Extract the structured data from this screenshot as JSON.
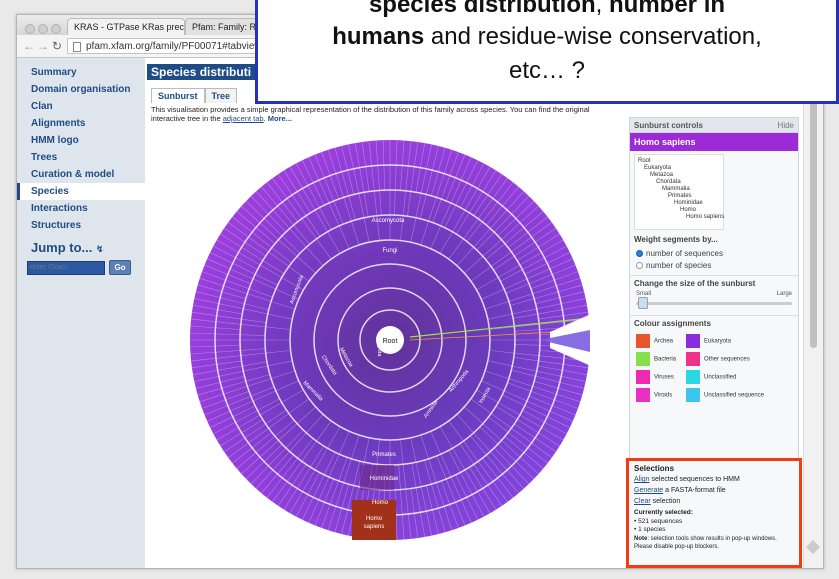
{
  "browser": {
    "tabs": [
      {
        "title": "KRAS - GTPase KRas prec",
        "close": "×"
      },
      {
        "title": "Pfam: Family: Ra"
      }
    ],
    "url": "pfam.xfam.org/family/PF00071#tabview=ta"
  },
  "sidebar": {
    "items": [
      {
        "label": "Summary"
      },
      {
        "label": "Domain organisation"
      },
      {
        "label": "Clan"
      },
      {
        "label": "Alignments"
      },
      {
        "label": "HMM logo"
      },
      {
        "label": "Trees"
      },
      {
        "label": "Curation & model"
      },
      {
        "label": "Species"
      },
      {
        "label": "Interactions"
      },
      {
        "label": "Structures"
      }
    ],
    "active_index": 7,
    "jump_title": "Jump to...",
    "jump_input_placeholder": "enter ID/acc",
    "go_label": "Go"
  },
  "main": {
    "section_title": "Species distributi",
    "tabs": [
      "Sunburst",
      "Tree"
    ],
    "description_1": "This visualisation provides a simple graphical representation of the distribution of this family across species. You can find the original interactive tree in the ",
    "description_link": "adjacent tab",
    "description_more": "More..."
  },
  "sunburst": {
    "labels": {
      "root": "Root",
      "eukaryota": "Eukaryota",
      "fungi": "Fungi",
      "ascomycota": "Ascomycota",
      "metazoa": "Metazoa",
      "chordata": "Chordata",
      "mammalia": "Mammalia",
      "primates": "Primates",
      "hominidae": "Hominidae",
      "homo": "Homo",
      "homo_sapiens_1": "Homo",
      "homo_sapiens_2": "sapiens",
      "arthropoda": "Arthropoda",
      "insecta": "Insecta",
      "amniota": "Amniota",
      "ascomycota2": "Ascomycota"
    }
  },
  "controls": {
    "title": "Sunburst controls",
    "hide_label": "Hide",
    "selected_species": "Homo sapiens",
    "taxonomy": [
      "Root",
      "Eukaryota",
      "Metazoa",
      "Chordata",
      "Mammalia",
      "Primates",
      "Hominidae",
      "Homo",
      "Homo sapiens"
    ],
    "weight_title": "Weight segments by...",
    "weight_options": [
      "number of sequences",
      "number of species"
    ],
    "weight_selected": 0,
    "size_title": "Change the size of the sunburst",
    "size_small": "Small",
    "size_large": "Large",
    "colour_title": "Colour assignments",
    "colours": [
      {
        "label": "Archea",
        "color": "#e8542b"
      },
      {
        "label": "Eukaryota",
        "color": "#8b2be0"
      },
      {
        "label": "Bacteria",
        "color": "#86e04a"
      },
      {
        "label": "Other sequences",
        "color": "#f0328a"
      },
      {
        "label": "Viruses",
        "color": "#f02ab0"
      },
      {
        "label": "Unclassified",
        "color": "#29d8e0"
      },
      {
        "label": "Viroids",
        "color": "#ec2fc4"
      },
      {
        "label": "Unclassified sequence",
        "color": "#3ec4ee"
      }
    ],
    "selections": {
      "title": "Selections",
      "align_link": "Align",
      "align_text": " selected sequences to HMM",
      "generate_link": "Generate",
      "generate_text": " a FASTA-format file",
      "clear_link": "Clear",
      "clear_text": " selection",
      "current_title": "Currently selected:",
      "seq_count": "521 sequences",
      "species_count": "1 species",
      "note_label": "Note",
      "note_text": ": selection tools show results in pop-up windows. Please disable pop-up blockers."
    }
  },
  "overlay": {
    "line1_bold_a": "species distribution",
    "line1_sep": ", ",
    "line1_bold_b": "number in",
    "line2_bold": "humans",
    "line2_rest": " and residue-wise conservation,",
    "line3": "etc… ?"
  }
}
